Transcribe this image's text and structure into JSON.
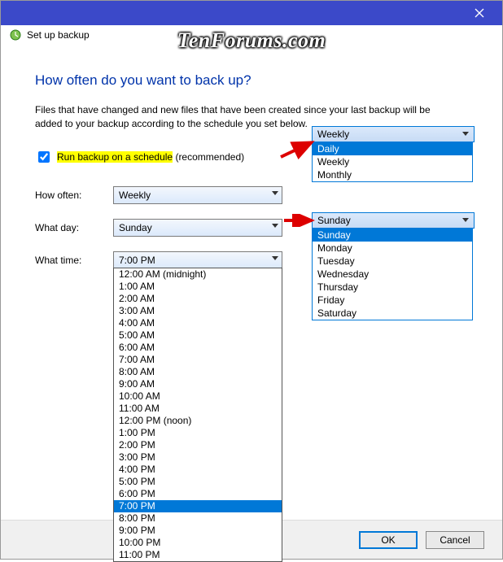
{
  "window": {
    "title": "Set up backup"
  },
  "watermark": "TenForums.com",
  "heading": "How often do you want to back up?",
  "description": "Files that have changed and new files that have been created since your last backup will be added to your backup according to the schedule you set below.",
  "checkbox": {
    "label_highlight": "Run backup on a schedule",
    "label_tail": " (recommended)",
    "checked": true
  },
  "fields": {
    "how_often": {
      "label": "How often:",
      "value": "Weekly"
    },
    "what_day": {
      "label": "What day:",
      "value": "Sunday"
    },
    "what_time": {
      "label": "What time:",
      "value": "7:00 PM"
    }
  },
  "popout_often": {
    "header": "Weekly",
    "options": [
      "Daily",
      "Weekly",
      "Monthly"
    ],
    "selected": "Daily"
  },
  "popout_day": {
    "header": "Sunday",
    "options": [
      "Sunday",
      "Monday",
      "Tuesday",
      "Wednesday",
      "Thursday",
      "Friday",
      "Saturday"
    ],
    "selected": "Sunday"
  },
  "time_options": [
    "12:00 AM (midnight)",
    "1:00 AM",
    "2:00 AM",
    "3:00 AM",
    "4:00 AM",
    "5:00 AM",
    "6:00 AM",
    "7:00 AM",
    "8:00 AM",
    "9:00 AM",
    "10:00 AM",
    "11:00 AM",
    "12:00 PM (noon)",
    "1:00 PM",
    "2:00 PM",
    "3:00 PM",
    "4:00 PM",
    "5:00 PM",
    "6:00 PM",
    "7:00 PM",
    "8:00 PM",
    "9:00 PM",
    "10:00 PM",
    "11:00 PM"
  ],
  "time_selected": "7:00 PM",
  "buttons": {
    "ok": "OK",
    "cancel": "Cancel"
  }
}
